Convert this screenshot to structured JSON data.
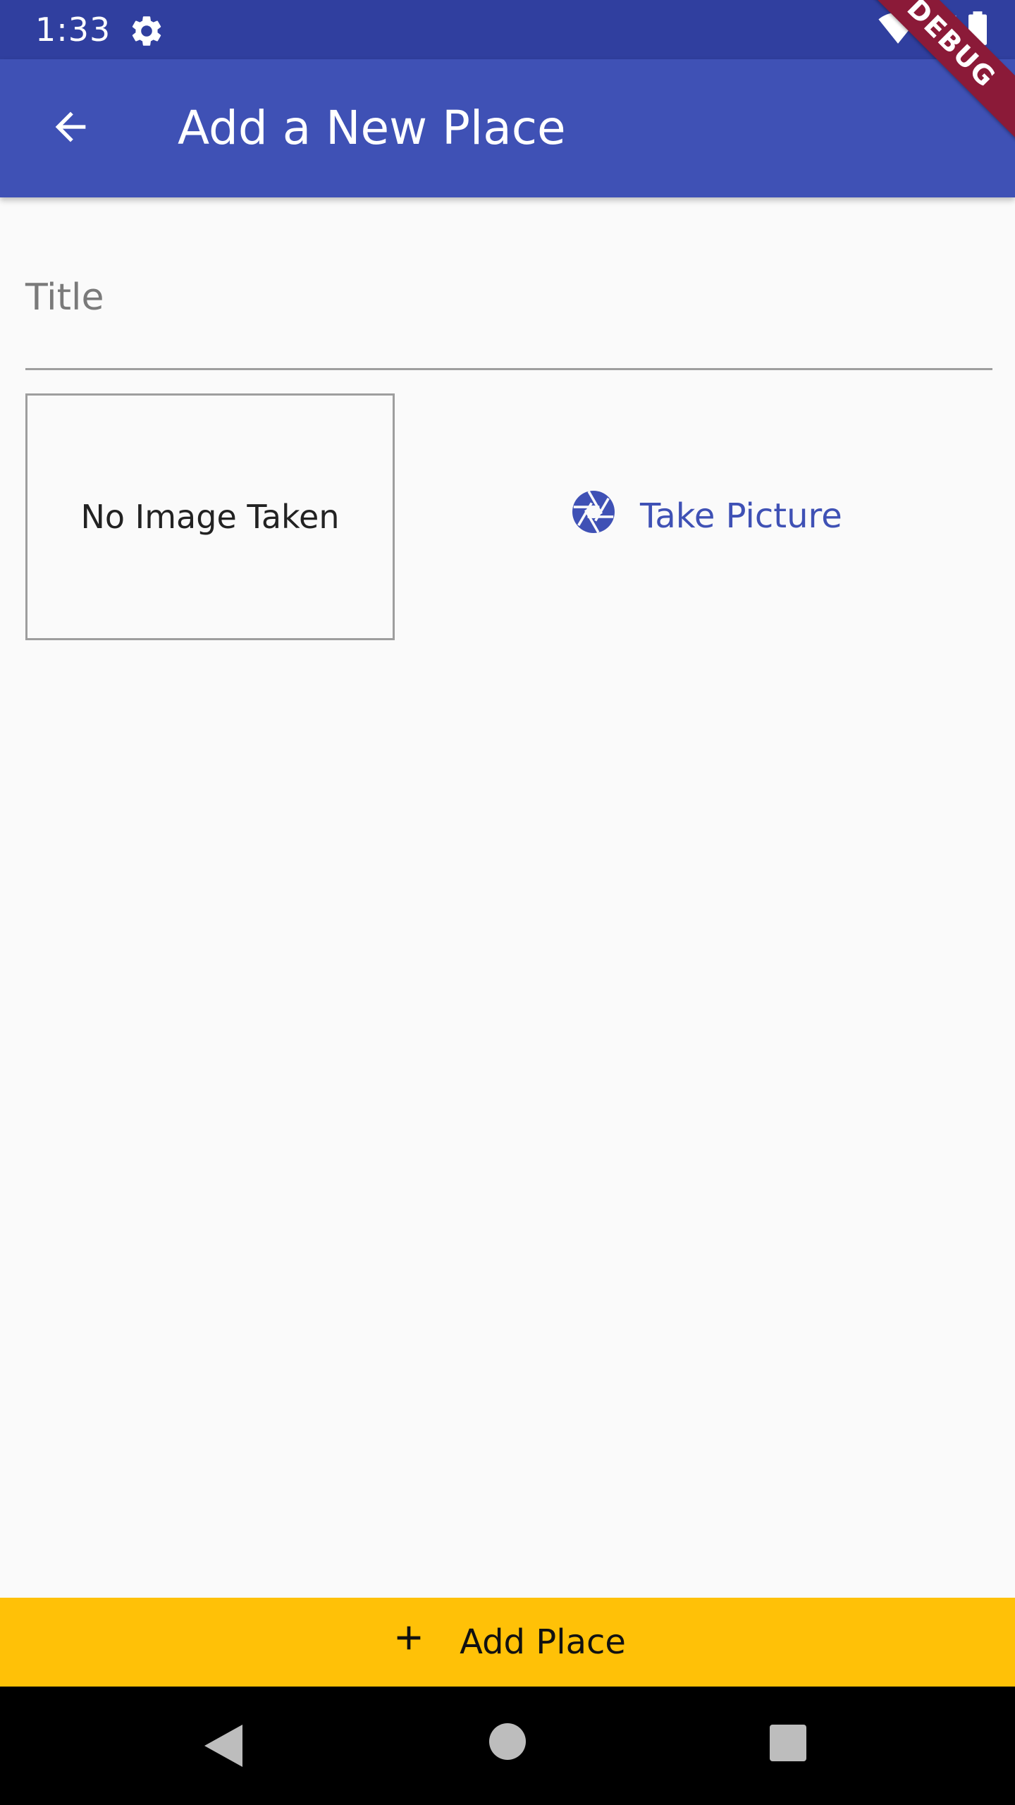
{
  "status_bar": {
    "time": "1:33",
    "icons": [
      "gear-icon",
      "wifi-icon",
      "signal-icon",
      "battery-icon"
    ]
  },
  "app_bar": {
    "title": "Add a New Place",
    "back_icon": "arrow-back-icon",
    "background_color": "#3f51b5"
  },
  "debug_banner": {
    "label": "DEBUG"
  },
  "form": {
    "title_placeholder": "Title",
    "title_value": ""
  },
  "image_preview": {
    "empty_text": "No Image Taken"
  },
  "take_picture_button": {
    "label": "Take Picture",
    "icon": "camera-shutter-icon",
    "color": "#3f51b5"
  },
  "add_place_button": {
    "label": "Add Place",
    "icon": "add-icon",
    "background_color": "#ffc107"
  },
  "nav_bar": {
    "icons": [
      "nav-back-icon",
      "nav-home-icon",
      "nav-recents-icon"
    ]
  }
}
